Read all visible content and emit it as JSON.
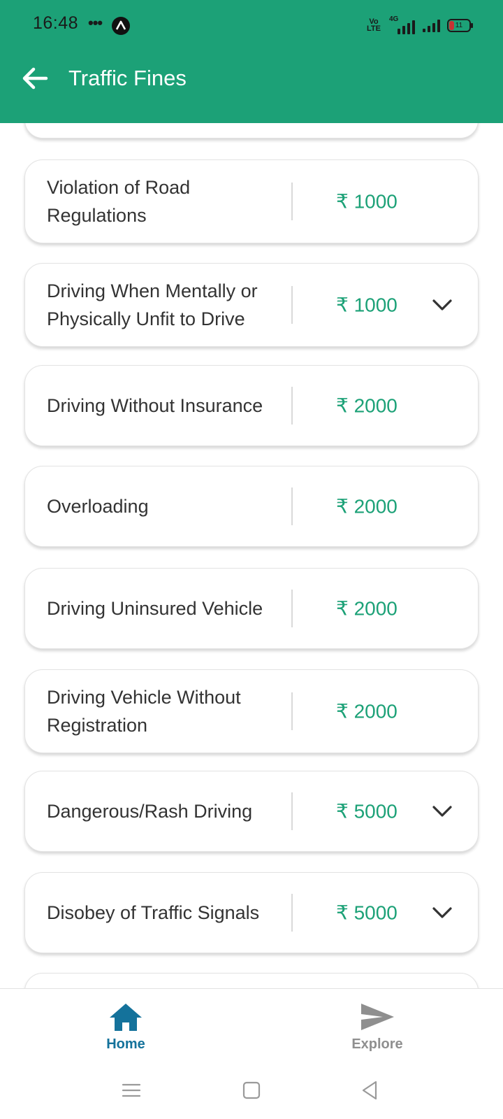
{
  "status_bar": {
    "time": "16:48",
    "dots": "•••",
    "volte": "Vo\nLTE",
    "network": "4G",
    "battery": "11"
  },
  "header": {
    "title": "Traffic Fines",
    "background": "#1ca177",
    "back_icon": "arrow-left-icon"
  },
  "fines": [
    {
      "label": "Violation of Road Regulations",
      "amount": "₹ 1000",
      "expandable": false
    },
    {
      "label": "Driving When Mentally or Physically Unfit to Drive",
      "amount": "₹ 1000",
      "expandable": true
    },
    {
      "label": "Driving Without Insurance",
      "amount": "₹ 2000",
      "expandable": false
    },
    {
      "label": "Overloading",
      "amount": "₹ 2000",
      "expandable": false
    },
    {
      "label": "Driving Uninsured Vehicle",
      "amount": "₹ 2000",
      "expandable": false
    },
    {
      "label": "Driving Vehicle Without Registration",
      "amount": "₹ 2000",
      "expandable": false
    },
    {
      "label": "Dangerous/Rash Driving",
      "amount": "₹ 5000",
      "expandable": true
    },
    {
      "label": "Disobey of Traffic Signals",
      "amount": "₹ 5000",
      "expandable": true
    }
  ],
  "bottom_nav": {
    "home": {
      "label": "Home",
      "icon": "home-icon",
      "color": "#14729b",
      "active": true
    },
    "explore": {
      "label": "Explore",
      "icon": "send-icon",
      "color": "#8f8f8f",
      "active": false
    }
  },
  "system_nav": [
    "menu-icon",
    "square-icon",
    "back-triangle-icon"
  ],
  "colors": {
    "accent": "#1ca177",
    "text": "#333333",
    "nav_active": "#14729b"
  }
}
